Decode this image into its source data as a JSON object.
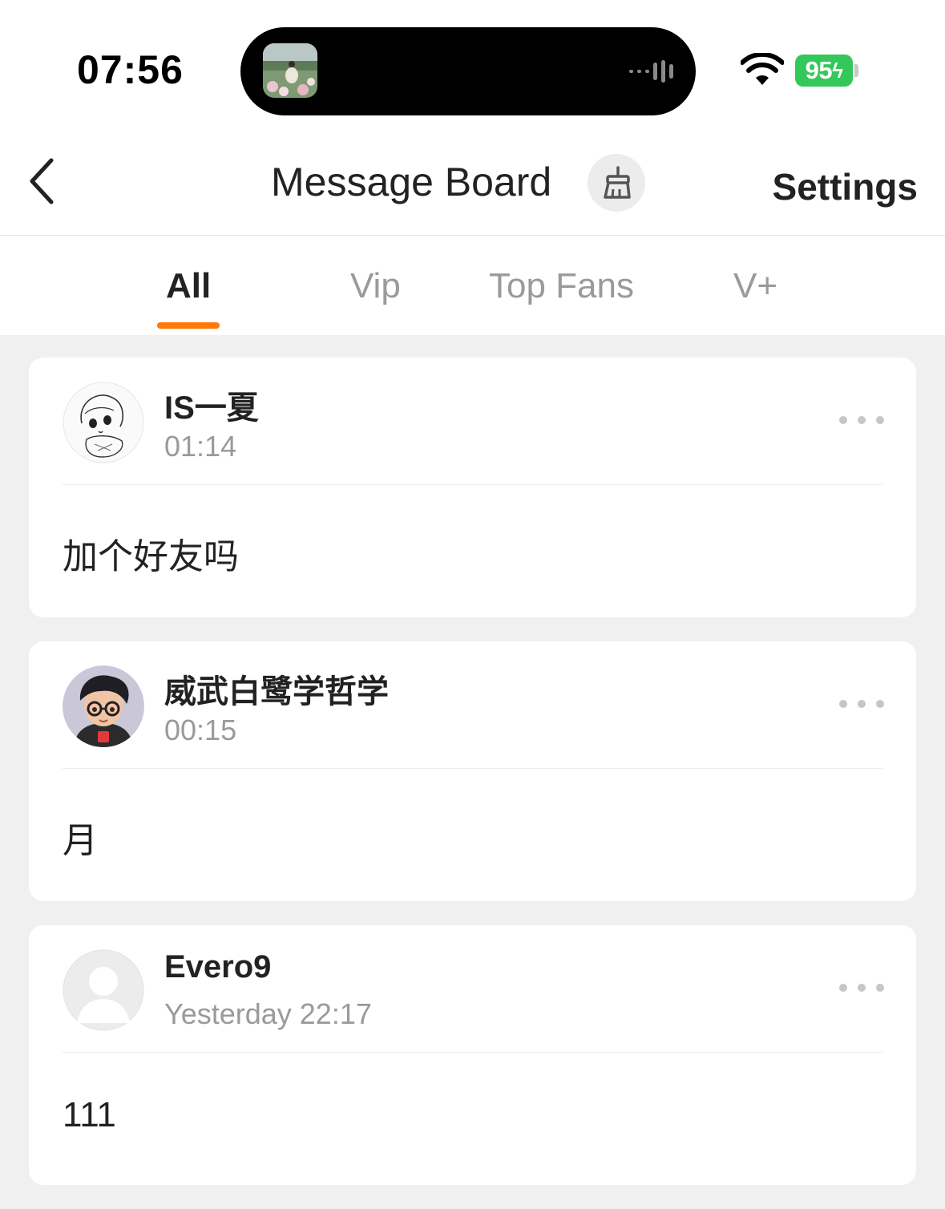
{
  "status_bar": {
    "time": "07:56",
    "battery": "95",
    "wifi_icon": "wifi-icon",
    "island_icons": [
      "now-playing-thumbnail",
      "audio-wave-icon"
    ]
  },
  "header": {
    "back_icon": "chevron-left-icon",
    "title": "Message Board",
    "clear_icon": "broom-icon",
    "settings_label": "Settings"
  },
  "tabs": [
    {
      "label": "All",
      "active": true
    },
    {
      "label": "Vip",
      "active": false
    },
    {
      "label": "Top Fans",
      "active": false
    },
    {
      "label": "V+",
      "active": false
    }
  ],
  "accent_color": "#ff7a0a",
  "messages": [
    {
      "author": "IS一夏",
      "time": "01:14",
      "content": "加个好友吗",
      "avatar": "sketch-avatar"
    },
    {
      "author": "威武白鹭学哲学",
      "time": "00:15",
      "content": "月",
      "avatar": "cartoon-boy-avatar"
    },
    {
      "author": "Evero9",
      "time": "Yesterday 22:17",
      "content": "111",
      "avatar": "default-user-avatar"
    }
  ]
}
